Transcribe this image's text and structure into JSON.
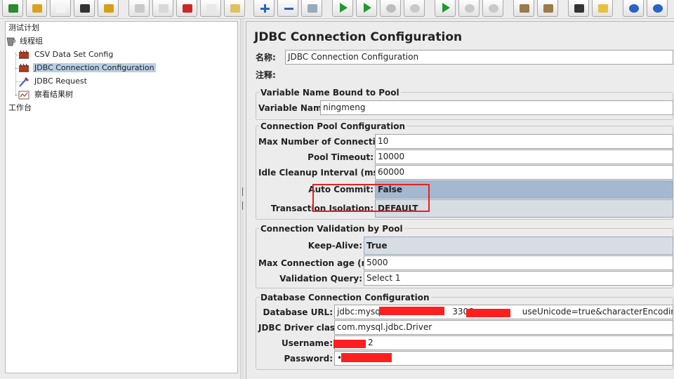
{
  "toolbar": {
    "buttons": [
      {
        "icon": "open-icon",
        "color": "#2d8a2d"
      },
      {
        "icon": "folder-icon",
        "color": "#d8a21e"
      },
      {
        "icon": "document-icon",
        "color": "#f4f4f4"
      },
      {
        "icon": "save-icon",
        "color": "#333333"
      },
      {
        "icon": "warning-stripes-icon",
        "color": "#d4a017"
      },
      {
        "icon": "cut-icon",
        "color": "#c8c8c8"
      },
      {
        "icon": "copy-disabled-icon",
        "color": "#d8d8d8"
      },
      {
        "icon": "scissors-icon",
        "color": "#c92828"
      },
      {
        "icon": "copy-icon",
        "color": "#e8e8e8"
      },
      {
        "icon": "paste-icon",
        "color": "#e0c060"
      },
      {
        "icon": "expand-icon",
        "color": "#2a62c6"
      },
      {
        "icon": "collapse-icon",
        "color": "#2a62c6"
      },
      {
        "icon": "toggle-icon",
        "color": "#9ab"
      },
      {
        "icon": "start-icon",
        "color": "#1e9b30"
      },
      {
        "icon": "start-no-pause-icon",
        "color": "#1e9b30"
      },
      {
        "icon": "stop-icon",
        "color": "#bdbdbd"
      },
      {
        "icon": "shutdown-icon",
        "color": "#c9c9c9"
      },
      {
        "icon": "remote-start-icon",
        "color": "#1e9b30"
      },
      {
        "icon": "remote-stop-icon",
        "color": "#c9c9c9"
      },
      {
        "icon": "remote-shutdown-icon",
        "color": "#c9c9c9"
      },
      {
        "icon": "clear-icon",
        "color": "#9b7b4a"
      },
      {
        "icon": "clear-all-icon",
        "color": "#9b7b4a"
      },
      {
        "icon": "search-binoculars-icon",
        "color": "#333333"
      },
      {
        "icon": "reset-search-icon",
        "color": "#e8c040"
      },
      {
        "icon": "function-helper-icon",
        "color": "#2a62c6"
      },
      {
        "icon": "help-icon",
        "color": "#2a62c6"
      }
    ]
  },
  "tree": {
    "items": [
      {
        "label": "测试计划",
        "icon": "test-plan-icon"
      },
      {
        "label": "线程组",
        "icon": "thread-group-icon"
      },
      {
        "label": "CSV Data Set Config",
        "icon": "config-element-icon"
      },
      {
        "label": "JDBC Connection Configuration",
        "icon": "config-element-icon"
      },
      {
        "label": "JDBC Request",
        "icon": "sampler-pipette-icon"
      },
      {
        "label": "察看结果树",
        "icon": "listener-graph-icon"
      },
      {
        "label": "工作台",
        "icon": "workbench-icon"
      }
    ]
  },
  "panel": {
    "title": "JDBC Connection Configuration",
    "name_label": "名称:",
    "name_value": "JDBC Connection Configuration",
    "comment_label": "注释:",
    "comment_value": ""
  },
  "variable_group": {
    "legend": "Variable Name Bound to Pool",
    "variable_name_label": "Variable Name:",
    "variable_name_value": "ningmeng"
  },
  "pool_group": {
    "legend": "Connection Pool Configuration",
    "max_connections_label": "Max Number of Connections:",
    "max_connections_value": "10",
    "pool_timeout_label": "Pool Timeout:",
    "pool_timeout_value": "10000",
    "idle_cleanup_label": "Idle Cleanup Interval (ms):",
    "idle_cleanup_value": "60000",
    "auto_commit_label": "Auto Commit:",
    "auto_commit_value": "False",
    "transaction_isolation_label": "Transaction Isolation:",
    "transaction_isolation_value": "DEFAULT"
  },
  "validation_group": {
    "legend": "Connection Validation by Pool",
    "keep_alive_label": "Keep-Alive:",
    "keep_alive_value": "True",
    "max_age_label": "Max Connection age (ms):",
    "max_age_value": "5000",
    "validation_query_label": "Validation Query:",
    "validation_query_value": "Select 1"
  },
  "database_group": {
    "legend": "Database Connection Configuration",
    "url_label": "Database URL:",
    "url_prefix": "jdbc:mysql:",
    "url_port": "3306",
    "url_suffix": "useUnicode=true&characterEncoding=utf",
    "driver_label": "JDBC Driver class:",
    "driver_value": "com.mysql.jdbc.Driver",
    "username_label": "Username:",
    "username_tail": "2",
    "password_label": "Password:",
    "password_value": "•"
  },
  "colors": {
    "annotation_red": "#e52222",
    "redaction_red": "#ff1f1f",
    "selection_blue": "#b8cfe5",
    "combo_selected_blue": "#a4b8d1"
  }
}
